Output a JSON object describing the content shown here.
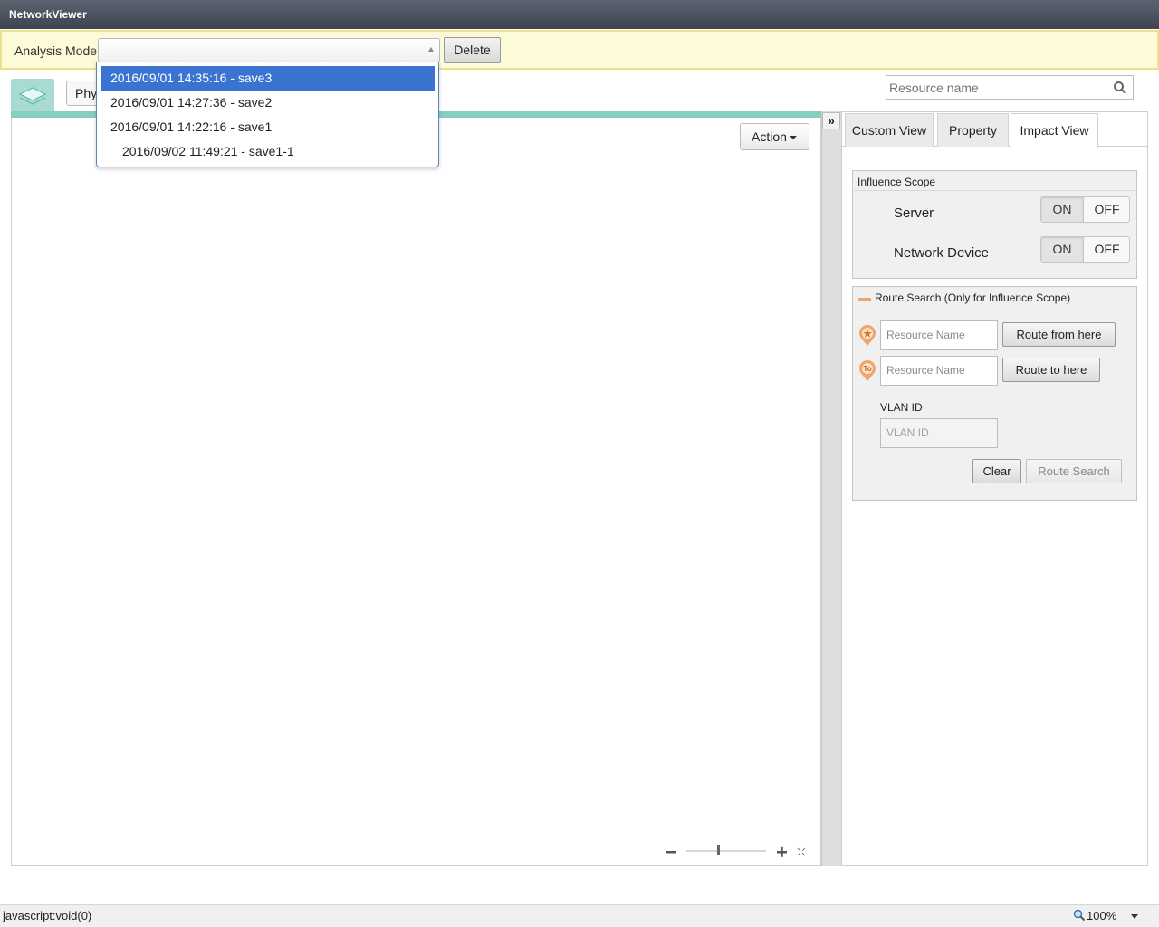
{
  "window": {
    "title": "NetworkViewer"
  },
  "mode_bar": {
    "label": "Analysis Mode",
    "select_value": "",
    "delete_label": "Delete",
    "options": [
      "2016/09/01 14:35:16 - save3",
      "2016/09/01 14:27:36 - save2",
      "2016/09/01 14:22:16 - save1",
      "2016/09/02 11:49:21 - save1-1"
    ],
    "selected_index": 0
  },
  "view": {
    "tab_label": "Phy",
    "action_label": "Action",
    "search_placeholder": "Resource name",
    "collapse_glyph": "»"
  },
  "right_panel": {
    "tabs": [
      "Custom View",
      "Property",
      "Impact View"
    ],
    "active_tab": "Impact View",
    "influence": {
      "legend": "Influence Scope",
      "rows": [
        {
          "label": "Server",
          "on": "ON",
          "off": "OFF"
        },
        {
          "label": "Network Device",
          "on": "ON",
          "off": "OFF"
        }
      ]
    },
    "route": {
      "legend": "Route Search (Only for Influence Scope)",
      "from_placeholder": "Resource Name",
      "to_placeholder": "Resource Name",
      "from_button": "Route from here",
      "to_button": "Route to here",
      "to_pin_text": "To",
      "vlan_label": "VLAN ID",
      "vlan_placeholder": "VLAN ID",
      "clear_label": "Clear",
      "search_label": "Route Search"
    }
  },
  "statusbar": {
    "text": "javascript:void(0)",
    "zoom": "100%"
  },
  "colors": {
    "accent": "#3b73d3",
    "teal_bar": "#86cfc0",
    "mode_bg": "#fdfbd7",
    "pin": "#f0a56b"
  },
  "icons": [
    "search-icon",
    "layers-icon",
    "star-pin-icon",
    "to-pin-icon",
    "zoom-out-icon",
    "zoom-in-icon",
    "fit-icon",
    "magnifier-icon"
  ]
}
